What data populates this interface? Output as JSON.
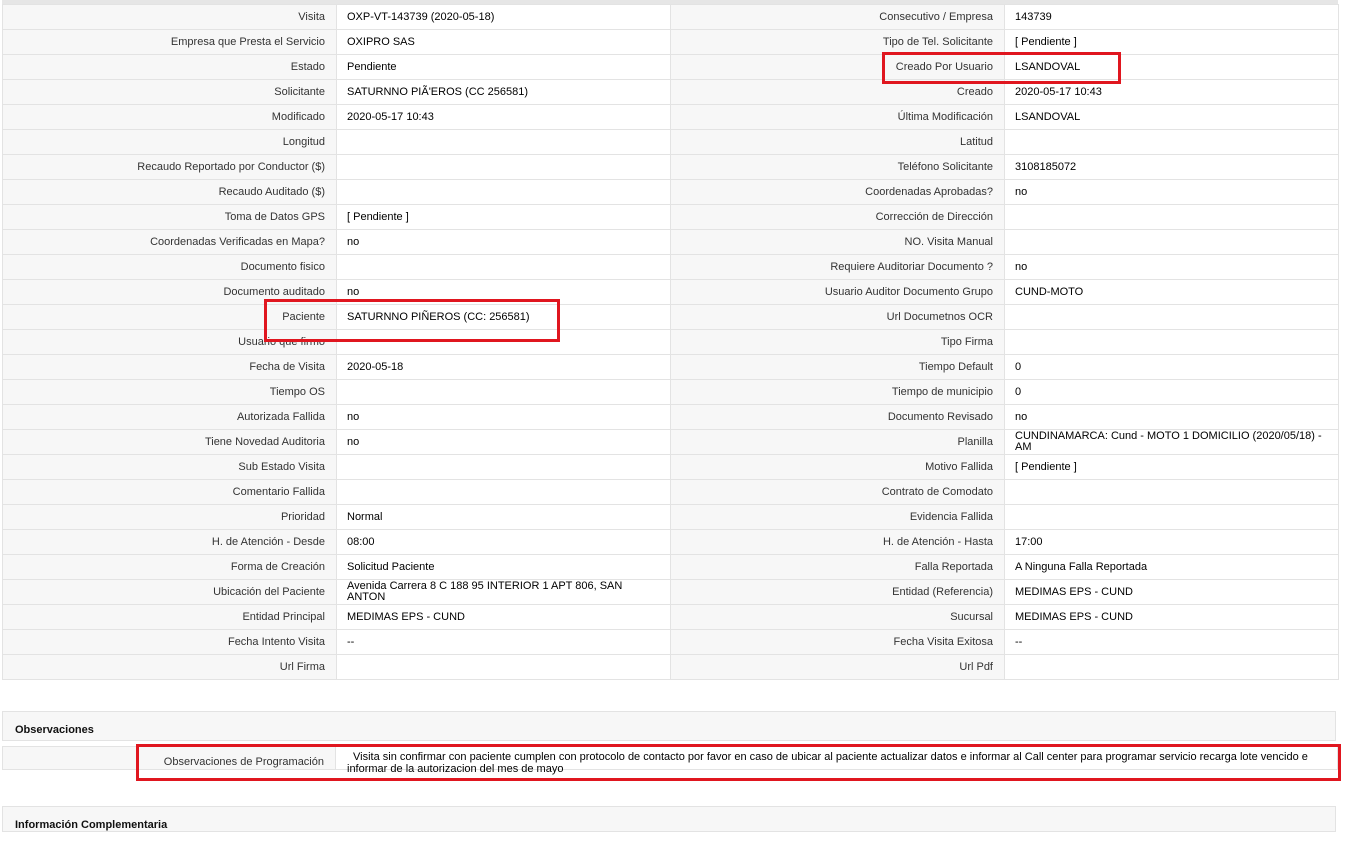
{
  "rows": [
    {
      "l1": "Visita",
      "v1": "OXP-VT-143739 (2020-05-18)",
      "l2": "Consecutivo / Empresa",
      "v2": "143739"
    },
    {
      "l1": "Empresa que Presta el Servicio",
      "v1": "OXIPRO SAS",
      "l2": "Tipo de Tel. Solicitante",
      "v2": "[ Pendiente ]"
    },
    {
      "l1": "Estado",
      "v1": "Pendiente",
      "l2": "Creado Por Usuario",
      "v2": "LSANDOVAL"
    },
    {
      "l1": "Solicitante",
      "v1": "SATURNNO PIÃ'EROS (CC 256581)",
      "l2": "Creado",
      "v2": "2020-05-17 10:43"
    },
    {
      "l1": "Modificado",
      "v1": "2020-05-17 10:43",
      "l2": "Última Modificación",
      "v2": " LSANDOVAL"
    },
    {
      "l1": "Longitud",
      "v1": "",
      "l2": "Latitud",
      "v2": ""
    },
    {
      "l1": "Recaudo Reportado por Conductor ($)",
      "v1": "",
      "l2": "Teléfono Solicitante",
      "v2": "3108185072"
    },
    {
      "l1": "Recaudo Auditado ($)",
      "v1": "",
      "l2": "Coordenadas Aprobadas?",
      "v2": " no"
    },
    {
      "l1": "Toma de Datos GPS",
      "v1": "[ Pendiente ]",
      "l2": "Corrección de Dirección",
      "v2": ""
    },
    {
      "l1": "Coordenadas Verificadas en Mapa?",
      "v1": " no",
      "l2": "NO. Visita Manual",
      "v2": ""
    },
    {
      "l1": "Documento fisico",
      "v1": "",
      "l2": "Requiere Auditoriar Documento ?",
      "v2": " no"
    },
    {
      "l1": "Documento auditado",
      "v1": " no",
      "l2": "Usuario Auditor Documento Grupo",
      "v2": "CUND-MOTO"
    },
    {
      "l1": "Paciente",
      "v1": "SATURNNO PIÑEROS (CC: 256581)",
      "l2": "Url Documetnos OCR",
      "v2": ""
    },
    {
      "l1": "Usuario que firmo",
      "v1": "",
      "l2": "Tipo Firma",
      "v2": ""
    },
    {
      "l1": "Fecha de Visita",
      "v1": " 2020-05-18",
      "l2": "Tiempo Default",
      "v2": "0"
    },
    {
      "l1": "Tiempo OS",
      "v1": "",
      "l2": "Tiempo de municipio",
      "v2": "0"
    },
    {
      "l1": "Autorizada Fallida",
      "v1": " no",
      "l2": "Documento Revisado",
      "v2": " no"
    },
    {
      "l1": "Tiene Novedad Auditoria",
      "v1": " no",
      "l2": "Planilla",
      "v2": "CUNDINAMARCA: Cund - MOTO 1 DOMICILIO (2020/05/18) - AM"
    },
    {
      "l1": "Sub Estado Visita",
      "v1": "",
      "l2": "Motivo Fallida",
      "v2": "[ Pendiente ]"
    },
    {
      "l1": "Comentario Fallida",
      "v1": "",
      "l2": "Contrato de Comodato",
      "v2": ""
    },
    {
      "l1": "Prioridad",
      "v1": "Normal",
      "l2": "Evidencia Fallida",
      "v2": ""
    },
    {
      "l1": "H. de Atención - Desde",
      "v1": "08:00",
      "l2": "H. de Atención - Hasta",
      "v2": " 17:00"
    },
    {
      "l1": "Forma de Creación",
      "v1": "Solicitud Paciente",
      "l2": "Falla Reportada",
      "v2": "A Ninguna Falla Reportada"
    },
    {
      "l1": "Ubicación del Paciente",
      "v1": "Avenida Carrera 8 C 188 95 INTERIOR 1 APT 806, SAN ANTON",
      "l2": "Entidad (Referencia)",
      "v2": "MEDIMAS EPS - CUND"
    },
    {
      "l1": "Entidad Principal",
      "v1": "MEDIMAS EPS - CUND",
      "l2": "Sucursal",
      "v2": "MEDIMAS EPS - CUND"
    },
    {
      "l1": "Fecha Intento Visita",
      "v1": " --",
      "l2": "Fecha Visita Exitosa",
      "v2": " --"
    },
    {
      "l1": "Url Firma",
      "v1": "",
      "l2": "Url Pdf",
      "v2": ""
    }
  ],
  "observaciones": {
    "title": "Observaciones",
    "label": "Observaciones de Programación",
    "value": "Visita sin confirmar con paciente cumplen con protocolo de contacto por favor en caso de ubicar al paciente actualizar datos e informar al Call center para programar servicio recarga lote vencido e informar de la autorizacion del mes de mayo"
  },
  "info_complementaria": {
    "title": "Información Complementaria"
  },
  "highlight_color": "#e0161f"
}
